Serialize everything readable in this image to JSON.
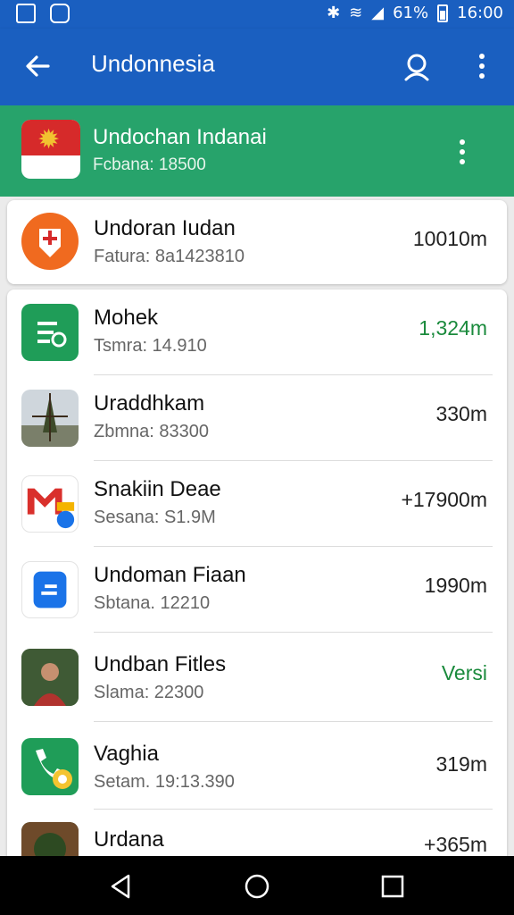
{
  "status_bar": {
    "battery": "61%",
    "time": "16:00"
  },
  "app_bar": {
    "title": "Undonnesia"
  },
  "header_item": {
    "title": "Undochan Indanai",
    "subtitle": "Fcbana: 18500"
  },
  "top_card": {
    "name": "Undoran Iudan",
    "subtitle": "Fatura: 8a1423810",
    "value": "10010m"
  },
  "list": [
    {
      "name": "Mohek",
      "subtitle": "Tsmra: 14.910",
      "value": "1,324m",
      "value_color": "#1a8a3c",
      "icon": "ledger-icon"
    },
    {
      "name": "Uraddhkam",
      "subtitle": "Zbmna: 83300",
      "value": "330m",
      "icon": "tree-icon"
    },
    {
      "name": "Snakiin Deae",
      "subtitle": "Sesana: S1.9M",
      "value": "+17900m",
      "icon": "mail-icon"
    },
    {
      "name": "Undoman Fiaan",
      "subtitle": "Sbtana. 12210",
      "value": "1990m",
      "icon": "app-icon"
    },
    {
      "name": "Undban Fitles",
      "subtitle": "Slama: 22300",
      "value": "Versi",
      "value_color": "#1a8a3c",
      "icon": "photo-icon"
    },
    {
      "name": "Vaghia",
      "subtitle": "Setam. 19:13.390",
      "value": "319m",
      "icon": "phone-icon"
    },
    {
      "name": "Urdana",
      "subtitle": "",
      "value": "+365m",
      "icon": "photo-icon"
    }
  ],
  "colors": {
    "app_bar": "#1a5fc0",
    "header": "#27a36b",
    "accent_green": "#1a8a3c"
  }
}
